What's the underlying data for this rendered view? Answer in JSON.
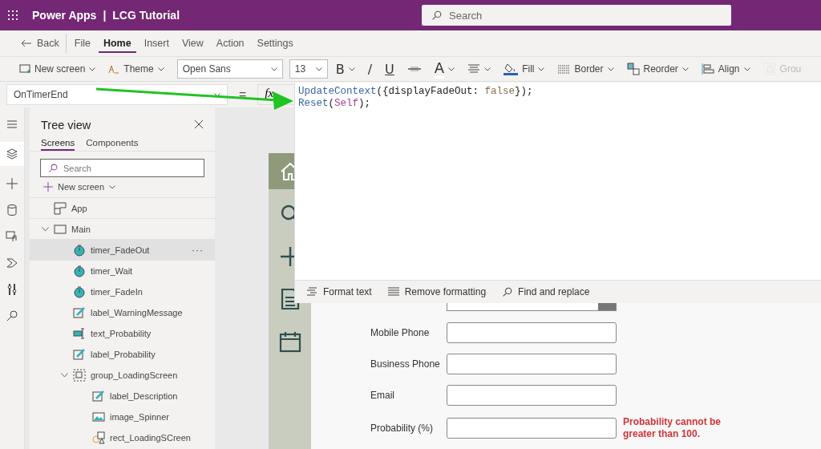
{
  "header": {
    "app_name": "Power Apps",
    "separator": "|",
    "project": "LCG Tutorial",
    "search": {
      "placeholder": "Search"
    }
  },
  "menu": [
    {
      "label": "Back",
      "kind": "back",
      "selected": false
    },
    {
      "label": "File",
      "kind": "tab",
      "selected": false
    },
    {
      "label": "Home",
      "kind": "tab",
      "selected": true
    },
    {
      "label": "Insert",
      "kind": "tab",
      "selected": false
    },
    {
      "label": "View",
      "kind": "tab",
      "selected": false
    },
    {
      "label": "Action",
      "kind": "tab",
      "selected": false
    },
    {
      "label": "Settings",
      "kind": "tab",
      "selected": false
    }
  ],
  "toolbar": [
    {
      "kind": "new-screen",
      "label": "New screen",
      "caret": true,
      "disabled": false
    },
    {
      "kind": "theme",
      "label": "Theme",
      "caret": true,
      "disabled": false
    },
    {
      "kind": "font",
      "label": "Open Sans",
      "caret": true,
      "disabled": false
    },
    {
      "kind": "size",
      "label": "13",
      "caret": true,
      "disabled": false
    },
    {
      "kind": "bold",
      "label": "B",
      "caret": true,
      "disabled": false
    },
    {
      "kind": "italic",
      "label": "/",
      "caret": false,
      "disabled": false
    },
    {
      "kind": "underline",
      "label": "U",
      "caret": false,
      "disabled": false
    },
    {
      "kind": "strike",
      "caret": false,
      "disabled": false
    },
    {
      "kind": "font-color",
      "label": "A",
      "caret": true,
      "disabled": false
    },
    {
      "kind": "text-align",
      "caret": true,
      "disabled": false
    },
    {
      "kind": "fill",
      "label": "Fill",
      "caret": true,
      "disabled": false
    },
    {
      "kind": "border",
      "label": "Border",
      "caret": true,
      "disabled": false
    },
    {
      "kind": "reorder",
      "label": "Reorder",
      "caret": true,
      "disabled": false
    },
    {
      "kind": "align",
      "label": "Align",
      "caret": true,
      "disabled": false
    },
    {
      "kind": "group",
      "label": "Grou",
      "caret": false,
      "disabled": true
    }
  ],
  "formula_bar": {
    "property": "OnTimerEnd",
    "equals": "=",
    "fx": "fx",
    "lines": [
      [
        {
          "text": "UpdateContext",
          "kind": "function"
        },
        {
          "text": "({displayFadeOut: ",
          "kind": "plain"
        },
        {
          "text": "false",
          "kind": "keyword"
        },
        {
          "text": "});",
          "kind": "plain"
        }
      ],
      [
        {
          "text": "Reset",
          "kind": "function"
        },
        {
          "text": "(",
          "kind": "plain"
        },
        {
          "text": "Self",
          "kind": "identifier"
        },
        {
          "text": ");",
          "kind": "plain"
        }
      ]
    ],
    "actions": [
      {
        "kind": "format",
        "label": "Format text"
      },
      {
        "kind": "remove",
        "label": "Remove formatting"
      },
      {
        "kind": "find",
        "label": "Find and replace"
      }
    ]
  },
  "rail": [
    {
      "kind": "menu",
      "selected": false
    },
    {
      "kind": "layers",
      "selected": true
    },
    {
      "kind": "insert",
      "selected": false
    },
    {
      "kind": "data",
      "selected": false
    },
    {
      "kind": "media",
      "selected": false
    },
    {
      "kind": "flow",
      "selected": false
    },
    {
      "kind": "tools",
      "selected": false
    },
    {
      "kind": "search",
      "selected": false
    }
  ],
  "tree_view": {
    "title": "Tree view",
    "tabs": [
      {
        "label": "Screens",
        "selected": true
      },
      {
        "label": "Components",
        "selected": false
      }
    ],
    "search": {
      "placeholder": "Search"
    },
    "new_screen": "New screen",
    "items": [
      {
        "label": "App",
        "kind": "app",
        "selected": false
      },
      {
        "label": "Main",
        "kind": "screen",
        "selected": false,
        "expanded": true,
        "children": [
          {
            "label": "timer_FadeOut",
            "kind": "timer",
            "selected": true,
            "more": "···"
          },
          {
            "label": "timer_Wait",
            "kind": "timer",
            "selected": false
          },
          {
            "label": "timer_FadeIn",
            "kind": "timer",
            "selected": false
          },
          {
            "label": "label_WarningMessage",
            "kind": "label",
            "selected": false
          },
          {
            "label": "text_Probability",
            "kind": "textinput",
            "selected": false
          },
          {
            "label": "label_Probability",
            "kind": "label",
            "selected": false
          },
          {
            "label": "group_LoadingScreen",
            "kind": "group",
            "selected": false,
            "expanded": true,
            "children": [
              {
                "label": "label_Description",
                "kind": "label",
                "selected": false
              },
              {
                "label": "image_Spinner",
                "kind": "image",
                "selected": false
              },
              {
                "label": "rect_LoadingSCreen",
                "kind": "rect",
                "selected": false
              }
            ]
          }
        ]
      }
    ]
  },
  "app_screen": {
    "nav": [
      {
        "kind": "home",
        "selected": true
      },
      {
        "kind": "search",
        "selected": false
      },
      {
        "kind": "add",
        "selected": false
      },
      {
        "kind": "document",
        "selected": false
      },
      {
        "kind": "calendar",
        "selected": false
      }
    ],
    "fields": [
      {
        "label": "Mobile Phone"
      },
      {
        "label": "Business Phone"
      },
      {
        "label": "Email"
      },
      {
        "label": "Probability (%)",
        "error": "Probability cannot be greater than 100."
      }
    ]
  }
}
